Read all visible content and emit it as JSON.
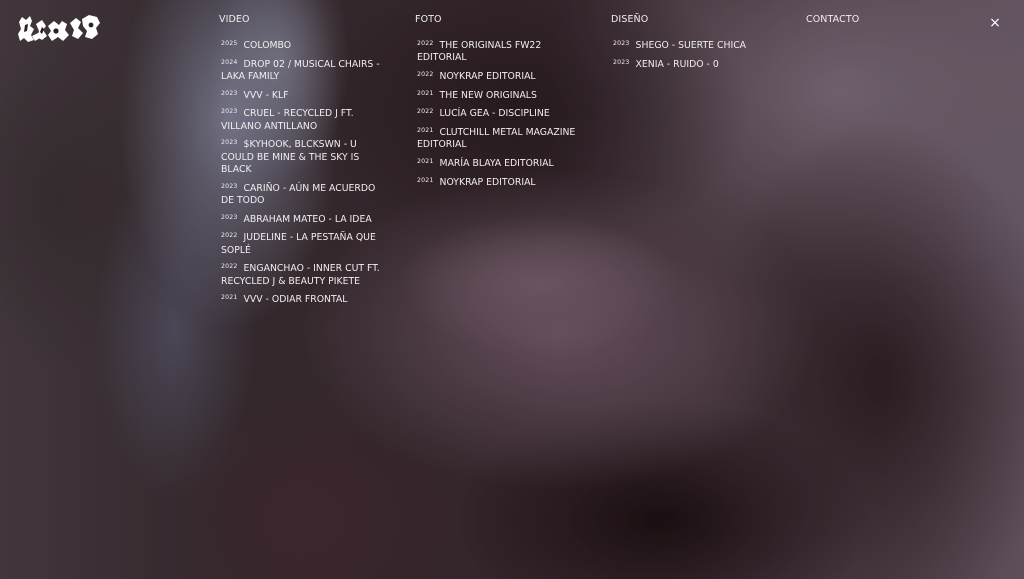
{
  "brand": {
    "logo_icon": "graffiti-wordmark-logo"
  },
  "nav": {
    "video": {
      "title": "VIDEO",
      "items": [
        {
          "year": "2025",
          "title": "COLOMBO"
        },
        {
          "year": "2024",
          "title": "DROP 02 / MUSICAL CHAIRS - LAKA FAMILY"
        },
        {
          "year": "2023",
          "title": "VVV - KLF"
        },
        {
          "year": "2023",
          "title": "CRUEL - RECYCLED J ft. VILLANO ANTILLANO"
        },
        {
          "year": "2023",
          "title": "$KYHOOK, BLCKSWN - U COULD BE MINE & THE SKY IS BLACK"
        },
        {
          "year": "2023",
          "title": "CARIÑO - AÚN ME ACUERDO DE TODO"
        },
        {
          "year": "2023",
          "title": "ABRAHAM MATEO - LA IDEA"
        },
        {
          "year": "2022",
          "title": "JUDELINE - LA PESTAÑA QUE SOPLÉ"
        },
        {
          "year": "2022",
          "title": "ENGANCHAO - INNER CUT ft. RECYCLED J & BEAUTY PIKETE"
        },
        {
          "year": "2021",
          "title": "VVV - ODIAR FRONTAL"
        }
      ]
    },
    "foto": {
      "title": "FOTO",
      "items": [
        {
          "year": "2022",
          "title": "THE ORIGINALS FW22 EDITORIAL"
        },
        {
          "year": "2022",
          "title": "NOYKRAP EDITORIAL"
        },
        {
          "year": "2021",
          "title": "THE NEW ORIGINALS"
        },
        {
          "year": "2022",
          "title": "LUCÍA GEA - DISCIPLINE"
        },
        {
          "year": "2021",
          "title": "CLUTCHILL METAL MAGAZINE EDITORIAL"
        },
        {
          "year": "2021",
          "title": "MARÍA BLAYA EDITORIAL"
        },
        {
          "year": "2021",
          "title": "NOYKRAP EDITORIAL"
        }
      ]
    },
    "diseno": {
      "title": "DISEÑO",
      "items": [
        {
          "year": "2023",
          "title": "SHEGO - SUERTE CHICA"
        },
        {
          "year": "2023",
          "title": "XENIA - RUIDO - 0"
        }
      ]
    },
    "contacto": {
      "title": "CONTACTO"
    }
  },
  "close": {
    "label": "×",
    "icon": "close-icon"
  },
  "colors": {
    "text": "#f2eef0",
    "background": "#2a2024"
  }
}
